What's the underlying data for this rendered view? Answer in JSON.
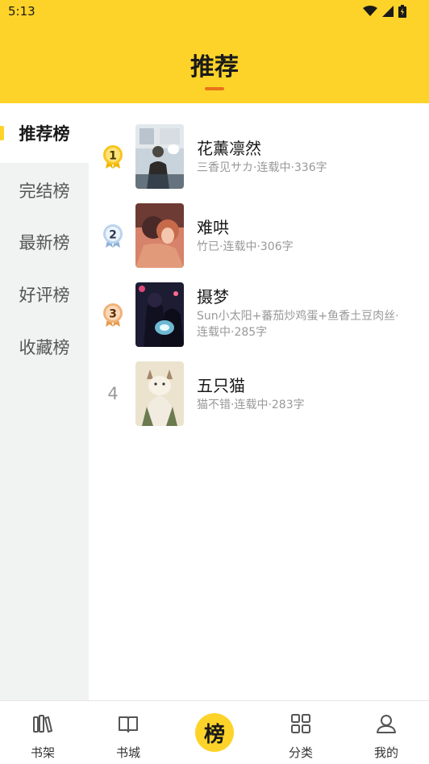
{
  "status_bar": {
    "time": "5:13"
  },
  "header": {
    "title": "推荐"
  },
  "sidebar": {
    "items": [
      {
        "label": "推荐榜",
        "active": true
      },
      {
        "label": "完结榜",
        "active": false
      },
      {
        "label": "最新榜",
        "active": false
      },
      {
        "label": "好评榜",
        "active": false
      },
      {
        "label": "收藏榜",
        "active": false
      }
    ]
  },
  "books": [
    {
      "rank": "1",
      "title": "花薰凛然",
      "meta": "三香见サカ·连载中·336字"
    },
    {
      "rank": "2",
      "title": "难哄",
      "meta": "竹已·连载中·306字"
    },
    {
      "rank": "3",
      "title": "摄梦",
      "meta": "Sun小太阳+蕃茄炒鸡蛋+鱼香土豆肉丝·连载中·285字"
    },
    {
      "rank": "4",
      "title": "五只猫",
      "meta": "猫不错·连载中·283字"
    }
  ],
  "tabbar": {
    "items": [
      {
        "label": "书架",
        "icon": "bookshelf-icon"
      },
      {
        "label": "书城",
        "icon": "open-book-icon"
      },
      {
        "label": "榜",
        "icon": "ranking-icon"
      },
      {
        "label": "分类",
        "icon": "category-grid-icon"
      },
      {
        "label": "我的",
        "icon": "user-icon"
      }
    ]
  },
  "colors": {
    "brand": "#fdd32a",
    "accent": "#e8731a",
    "gold": "#f0b400",
    "silver": "#8fb1d8",
    "bronze": "#e79a4f"
  }
}
